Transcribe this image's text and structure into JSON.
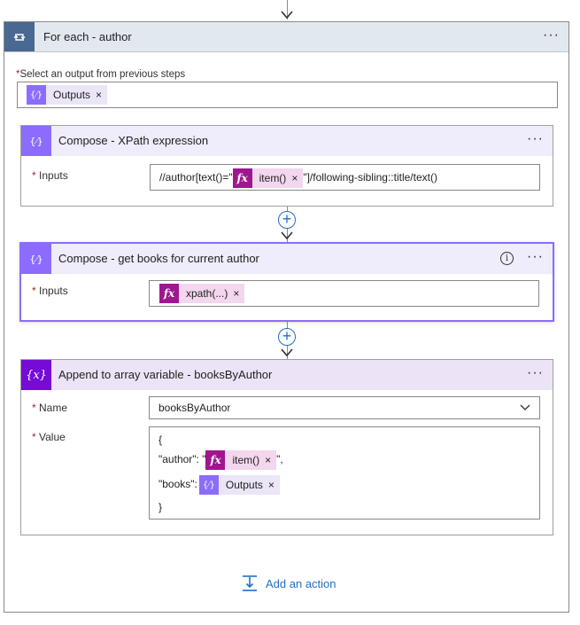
{
  "foreach": {
    "title": "For each - author",
    "more": "···",
    "select_label": "Select an output from previous steps",
    "select_token": "Outputs",
    "token_remove": "×"
  },
  "compose_xpath": {
    "title": "Compose - XPath expression",
    "more": "···",
    "inputs_label": "Inputs",
    "prefix": "//author[text()=\"",
    "fx_token": "item()",
    "suffix": "\"]/following-sibling::title/text()"
  },
  "compose_books": {
    "title": "Compose - get books for current author",
    "info": "i",
    "more": "···",
    "inputs_label": "Inputs",
    "fx_token": "xpath(...)"
  },
  "append": {
    "title": "Append to array variable - booksByAuthor",
    "more": "···",
    "name_label": "Name",
    "name_value": "booksByAuthor",
    "value_label": "Value",
    "line_open": "{",
    "author_key": "\"author\": \"",
    "author_token": "item()",
    "author_end": "\",",
    "books_key": "\"books\":",
    "books_token": "Outputs",
    "line_close": "}"
  },
  "icons": {
    "fx": "fx",
    "compose": "{⁄}",
    "variable": "{x}"
  },
  "add_action_label": "Add an action",
  "colors": {
    "foreach_icon": "#486991",
    "compose_icon": "#8c6cff",
    "variable_icon": "#770bd6",
    "fx_icon": "#a0168f",
    "accent": "#1f6fc7"
  }
}
